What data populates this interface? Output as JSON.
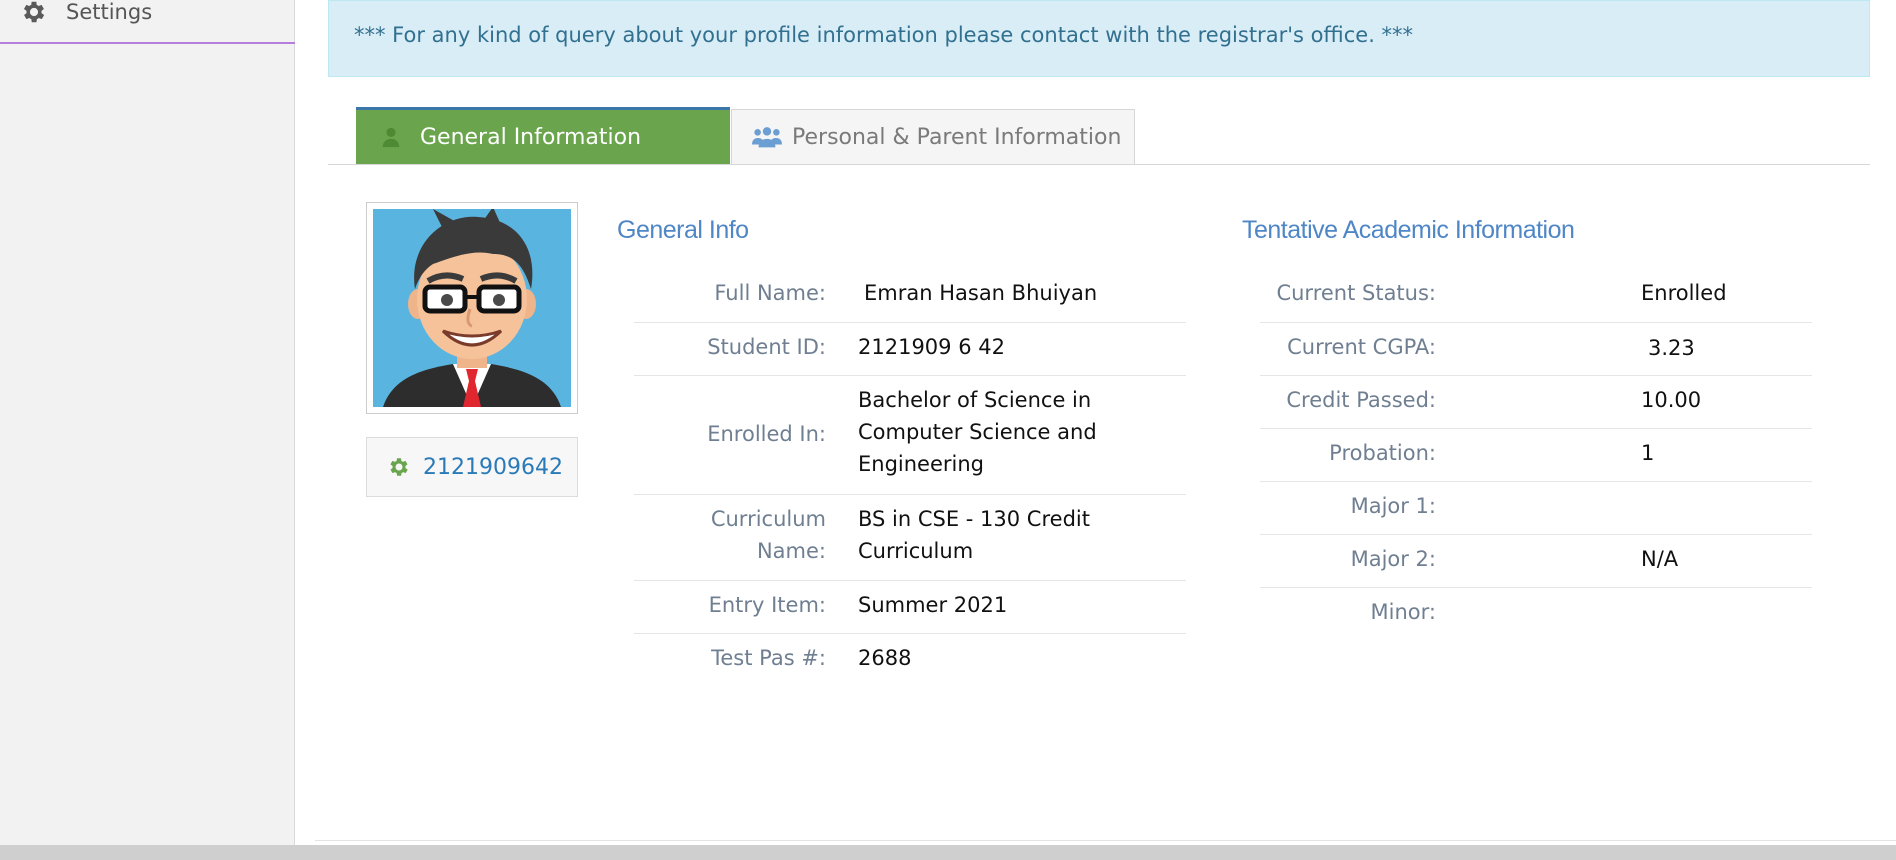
{
  "sidebar": {
    "items": [
      {
        "label": "Settings",
        "icon": "gear-icon"
      }
    ],
    "accent_color": "#b57edc"
  },
  "alert": {
    "text": "*** For any kind of query about your profile information please contact with the registrar's office. ***"
  },
  "tabs": [
    {
      "label": "General Information",
      "icon": "user-icon",
      "active": true
    },
    {
      "label": "Personal & Parent Information",
      "icon": "users-icon",
      "active": false
    }
  ],
  "profile": {
    "student_id_link": "2121909642"
  },
  "general_info": {
    "title": "General Info",
    "rows": [
      {
        "label": "Full Name:",
        "value": "Emran Hasan Bhuiyan"
      },
      {
        "label": "Student ID:",
        "value": "2121909 6 42"
      },
      {
        "label": "Enrolled In:",
        "value": "Bachelor of Science in Computer Science and Engineering"
      },
      {
        "label": "Curriculum Name:",
        "value": "BS in CSE - 130 Credit Curriculum"
      },
      {
        "label": "Entry Item:",
        "value": "Summer 2021"
      },
      {
        "label": "Test Pas #:",
        "value": "2688"
      }
    ]
  },
  "academic_info": {
    "title": "Tentative Academic Information",
    "rows": [
      {
        "label": "Current Status:",
        "value": "Enrolled"
      },
      {
        "label": "Current CGPA:",
        "value": "3.23"
      },
      {
        "label": "Credit Passed:",
        "value": "10.00"
      },
      {
        "label": "Probation:",
        "value": "1"
      },
      {
        "label": "Major 1:",
        "value": ""
      },
      {
        "label": "Major 2:",
        "value": "N/A"
      },
      {
        "label": "Minor:",
        "value": ""
      }
    ]
  },
  "colors": {
    "active_tab": "#6aa54d",
    "alert_bg": "#d9edf7",
    "alert_text": "#31708f",
    "section_title": "#4f86c6",
    "link": "#2a7ab8"
  }
}
